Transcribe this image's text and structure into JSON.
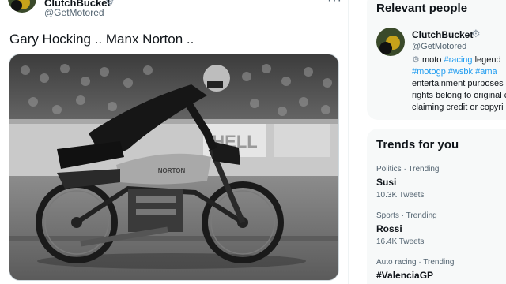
{
  "tweet": {
    "author_name": "ClutchBucket",
    "author_handle": "@GetMotored",
    "text": "Gary Hocking .. Manx Norton ..",
    "more_label": "···",
    "media_caption_sign": "HELL",
    "media_tank_brand": "NORTON"
  },
  "sidebar": {
    "relevant": {
      "title": "Relevant people",
      "person": {
        "name": "ClutchBucket",
        "handle": "@GetMotored",
        "bio_line1_text": "moto",
        "bio_line1_tag1": "#racing",
        "bio_line1_tail": "legend",
        "bio_line2_tag1": "#motogp",
        "bio_line2_tag2": "#wsbk",
        "bio_line2_tag3": "#ama",
        "bio_line3": "entertainment purposes",
        "bio_line4": "rights belong to original c",
        "bio_line5": "claiming credit or copyri"
      }
    },
    "trends": {
      "title": "Trends for you",
      "items": [
        {
          "meta": "Politics · Trending",
          "name": "Susi",
          "count": "10.3K Tweets"
        },
        {
          "meta": "Sports · Trending",
          "name": "Rossi",
          "count": "16.4K Tweets"
        },
        {
          "meta": "Auto racing · Trending",
          "name": "#ValenciaGP",
          "count": ""
        }
      ]
    }
  },
  "icons": {
    "verified_gear": "gear-icon",
    "more": "more-icon"
  }
}
